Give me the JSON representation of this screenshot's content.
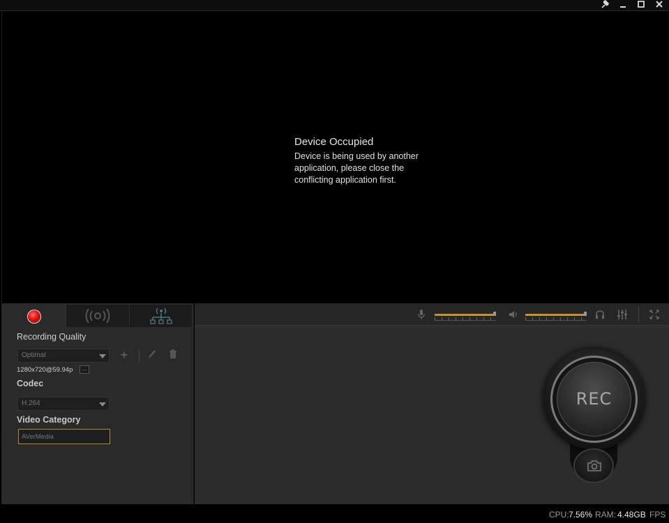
{
  "titlebar": {
    "icons": [
      "pin-icon",
      "minimize-icon",
      "maximize-icon",
      "close-icon"
    ]
  },
  "preview": {
    "message_title": "Device Occupied",
    "message_line1": "Device is being used by another",
    "message_line2": "application, please close the",
    "message_line3": "conflicting application first."
  },
  "tabs": {
    "items": [
      {
        "name": "record",
        "icon": "record-dot-icon",
        "active": true
      },
      {
        "name": "stream",
        "icon": "broadcast-icon",
        "active": false
      },
      {
        "name": "network",
        "icon": "network-icon",
        "active": false
      }
    ]
  },
  "recording": {
    "quality_label": "Recording Quality",
    "quality_value": "Optimal",
    "resolution": "1280x720@59.94p",
    "more_label": "...",
    "codec_label": "Codec",
    "codec_value": "H.264",
    "category_label": "Video Category",
    "category_placeholder": "AVerMedia"
  },
  "audio": {
    "mic_level": 0.97,
    "speaker_level": 0.97
  },
  "controls": {
    "rec_label": "REC"
  },
  "status": {
    "cpu_label": "CPU:",
    "cpu_value": "7.56%",
    "ram_label": "RAM:",
    "ram_value": "4.48GB",
    "fps_label": "FPS"
  },
  "colors": {
    "accent": "#c7902f",
    "record_red": "#e01010"
  }
}
